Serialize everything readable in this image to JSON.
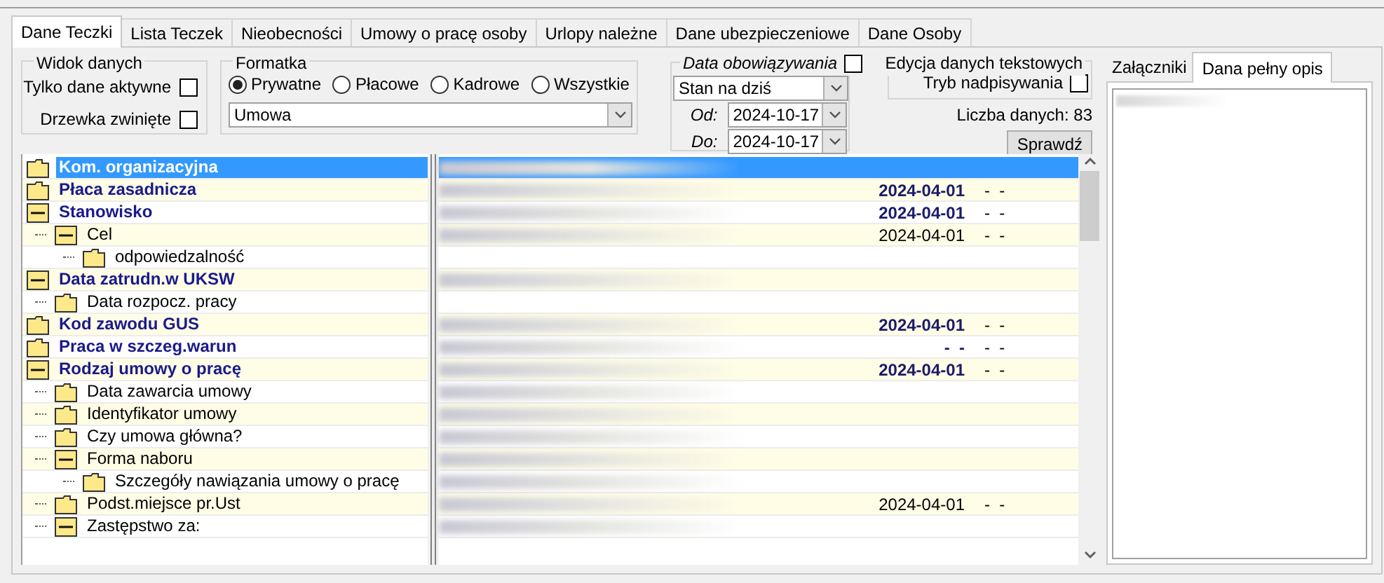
{
  "tabs": [
    {
      "label": "Dane Teczki",
      "selected": true
    },
    {
      "label": "Lista Teczek",
      "selected": false
    },
    {
      "label": "Nieobecności",
      "selected": false
    },
    {
      "label": "Umowy o pracę osoby",
      "selected": false
    },
    {
      "label": "Urlopy należne",
      "selected": false
    },
    {
      "label": "Dane ubezpieczeniowe",
      "selected": false
    },
    {
      "label": "Dane Osoby",
      "selected": false
    }
  ],
  "view_group": {
    "title": "Widok danych",
    "options": [
      {
        "label": "Tylko dane aktywne",
        "checked": false
      },
      {
        "label": "Drzewka zwinięte",
        "checked": false
      }
    ]
  },
  "form_group": {
    "title": "Formatka",
    "radios": [
      {
        "label": "Prywatne",
        "selected": true
      },
      {
        "label": "Płacowe",
        "selected": false
      },
      {
        "label": "Kadrowe",
        "selected": false
      },
      {
        "label": "Wszystkie",
        "selected": false
      }
    ],
    "dropdown": "Umowa"
  },
  "date_group": {
    "title": "Data obowiązywania",
    "checked": false,
    "mode": "Stan na dziś",
    "from_label": "Od:",
    "from": "2024-10-17",
    "to_label": "Do:",
    "to": "2024-10-17"
  },
  "edit_group": {
    "title": "Edycja danych tekstowych",
    "option": "Tryb nadpisywania",
    "checked": false
  },
  "count": "Liczba danych: 83",
  "check_button": "Sprawdź",
  "tree": [
    {
      "label": "Kom. organizacyjna",
      "expanded": false,
      "selected": true,
      "blurred": true
    },
    {
      "label": "Płaca zasadnicza",
      "expanded": false,
      "selected": false,
      "blurred": true,
      "date": "2024-04-01",
      "range": "-  -"
    },
    {
      "label": "Stanowisko",
      "expanded": true,
      "selected": false,
      "blurred": true,
      "date": "2024-04-01",
      "range": "-  -",
      "children": [
        {
          "label": "Cel",
          "expanded": true,
          "selected": false,
          "blurred": true,
          "date": "2024-04-01",
          "range": "-  -",
          "children": [
            {
              "label": "odpowiedzalność",
              "expanded": false,
              "selected": false,
              "blurred": false
            }
          ]
        }
      ]
    },
    {
      "label": "Data zatrudn.w UKSW",
      "expanded": true,
      "selected": false,
      "blurred": true,
      "children": [
        {
          "label": "Data rozpocz. pracy",
          "expanded": false,
          "selected": false,
          "blurred": false
        }
      ]
    },
    {
      "label": "Kod zawodu GUS",
      "expanded": false,
      "selected": false,
      "blurred": true,
      "date": "2024-04-01",
      "range": "-  -"
    },
    {
      "label": "Praca w szczeg.warun",
      "expanded": false,
      "selected": false,
      "blurred": true,
      "date": "-  -",
      "range": "-  -"
    },
    {
      "label": "Rodzaj umowy o pracę",
      "expanded": true,
      "selected": false,
      "blurred": true,
      "date": "2024-04-01",
      "range": "-  -",
      "children": [
        {
          "label": "Data zawarcia umowy",
          "expanded": false,
          "selected": false,
          "blurred": true
        },
        {
          "label": "Identyfikator umowy",
          "expanded": false,
          "selected": false,
          "blurred": true
        },
        {
          "label": "Czy umowa główna?",
          "expanded": false,
          "selected": false,
          "blurred": true
        },
        {
          "label": "Forma naboru",
          "expanded": true,
          "selected": false,
          "blurred": true,
          "children": [
            {
              "label": "Szczegóły nawiązania umowy o pracę",
              "expanded": false,
              "selected": false,
              "blurred": true
            }
          ]
        },
        {
          "label": "Podst.miejsce pr.Ust",
          "expanded": false,
          "selected": false,
          "blurred": true,
          "date": "2024-04-01",
          "range": "-  -"
        },
        {
          "label": "Zastępstwo za:",
          "expanded": true,
          "selected": false,
          "blurred": true
        }
      ]
    }
  ],
  "side_tabs": [
    {
      "label": "Załączniki",
      "selected": false
    },
    {
      "label": "Dana pełny opis",
      "selected": true
    }
  ]
}
